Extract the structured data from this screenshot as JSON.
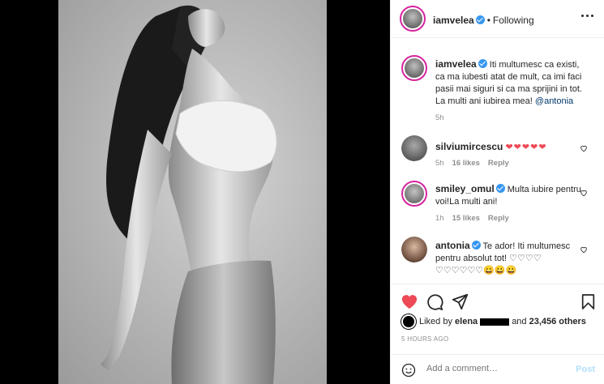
{
  "header": {
    "username": "iamvelea",
    "following_label": "Following",
    "separator": "•"
  },
  "caption": {
    "username": "iamvelea",
    "text": "Iti multumesc ca existi, ca ma iubesti atat de mult, ca imi faci pasii mai siguri si ca ma sprijini in tot. La multi ani iubirea mea! ",
    "mention": "@antonia",
    "time": "5h"
  },
  "comments": [
    {
      "username": "silviumircescu",
      "text": "",
      "emoji": "❤❤❤❤❤",
      "time": "5h",
      "likes": "16 likes",
      "reply": "Reply"
    },
    {
      "username": "smiley_omul",
      "text": "Multa iubire pentru voi!La multi ani!",
      "time": "1h",
      "likes": "15 likes",
      "reply": "Reply"
    },
    {
      "username": "antonia",
      "text": "Te ador! Iti multumesc pentru absolut tot! ♡♡♡♡ ♡♡♡♡♡♡😀😀😀"
    }
  ],
  "likes": {
    "prefix": "Liked by ",
    "name": "elena",
    "middle": " and ",
    "count": "23,456 others"
  },
  "timestamp": "5 HOURS AGO",
  "add_comment": {
    "placeholder": "Add a comment…",
    "post_label": "Post"
  },
  "colors": {
    "verified": "#3897f0",
    "like_red": "#ed4956",
    "story_ring": "#d6249f",
    "post_disabled": "#b2dffc"
  }
}
